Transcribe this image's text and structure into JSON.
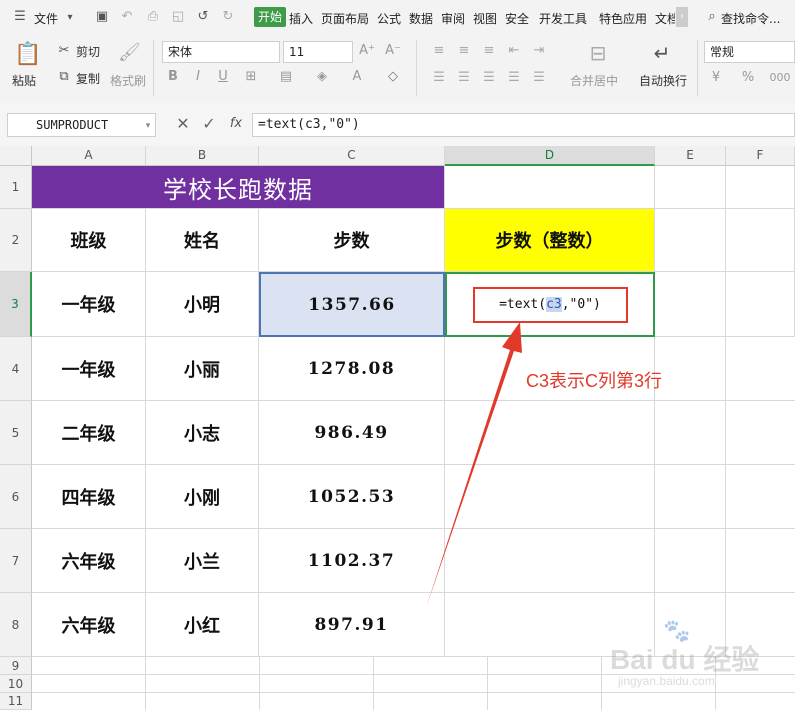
{
  "menubar": {
    "file_label": "文件",
    "tabs": [
      "开始",
      "插入",
      "页面布局",
      "公式",
      "数据",
      "审阅",
      "视图",
      "安全",
      "开发工具",
      "特色应用",
      "文档"
    ],
    "search_label": "查找命令..."
  },
  "ribbon": {
    "paste_label": "粘贴",
    "cut_label": "剪切",
    "copy_label": "复制",
    "format_painter_label": "格式刷",
    "font_name": "宋体",
    "font_size": "11",
    "merge_center_label": "合并居中",
    "wrap_text_label": "自动换行",
    "number_format": "常规"
  },
  "formula_bar": {
    "name_box": "SUMPRODUCT",
    "fx_label": "fx",
    "formula": "=text(c3,\"0\")"
  },
  "sheet": {
    "columns": [
      "A",
      "B",
      "C",
      "D",
      "E",
      "F"
    ],
    "rows": [
      "1",
      "2",
      "3",
      "4",
      "5",
      "6",
      "7",
      "8",
      "9",
      "10",
      "11"
    ],
    "title": "学校长跑数据",
    "headers": {
      "class": "班级",
      "name": "姓名",
      "steps": "步数",
      "steps_int": "步数（整数）"
    },
    "records": [
      {
        "class": "一年级",
        "name": "小明",
        "steps": "1357.66"
      },
      {
        "class": "一年级",
        "name": "小丽",
        "steps": "1278.08"
      },
      {
        "class": "二年级",
        "name": "小志",
        "steps": "986.49"
      },
      {
        "class": "四年级",
        "name": "小刚",
        "steps": "1052.53"
      },
      {
        "class": "六年级",
        "name": "小兰",
        "steps": "1102.37"
      },
      {
        "class": "六年级",
        "name": "小红",
        "steps": "897.91"
      }
    ],
    "edit_formula": {
      "prefix": "=text(",
      "ref": "c3",
      "suffix": ",\"0\")"
    }
  },
  "annotation": {
    "text": "C3表示C列第3行",
    "color": "#e23a2a"
  },
  "colors": {
    "title_bg": "#7030a0",
    "header_highlight": "#ffff00",
    "selection_fill": "#dbe3f3",
    "accent_green": "#3e9b4a"
  },
  "watermark": {
    "brand": "Bai du 经验",
    "url": "jingyan.baidu.com"
  }
}
